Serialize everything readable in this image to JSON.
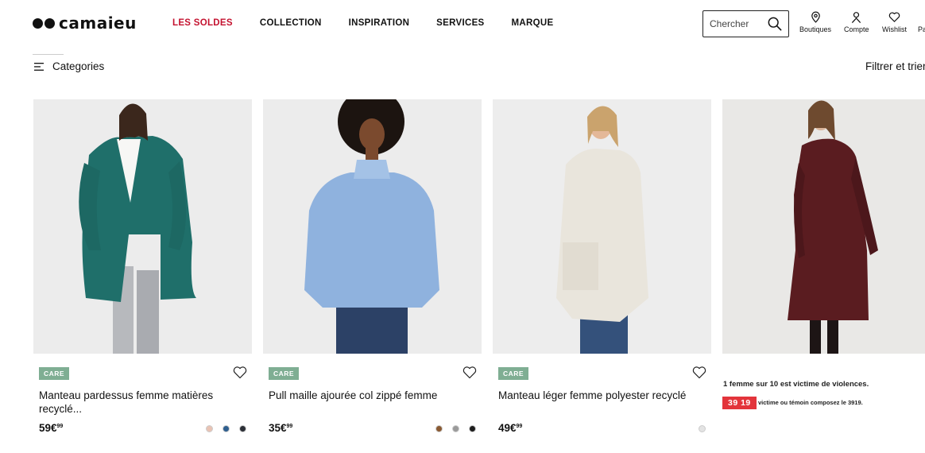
{
  "brand": {
    "name": "camaieu"
  },
  "nav": [
    {
      "label": "LES SOLDES"
    },
    {
      "label": "COLLECTION"
    },
    {
      "label": "INSPIRATION"
    },
    {
      "label": "SERVICES"
    },
    {
      "label": "MARQUE"
    }
  ],
  "search": {
    "placeholder": "Chercher"
  },
  "utilities": [
    {
      "label": "Boutiques",
      "icon": "store-pin-icon"
    },
    {
      "label": "Compte",
      "icon": "user-icon"
    },
    {
      "label": "Wishlist",
      "icon": "heart-icon"
    },
    {
      "label": "Pa",
      "icon": "bag-icon"
    }
  ],
  "toolbar": {
    "categories_label": "Categories",
    "filter_label": "Filtrer et trier"
  },
  "products": [
    {
      "badge": "CARE",
      "title": "Manteau pardessus femme matières recyclé...",
      "price_main": "59€",
      "price_cents": "99",
      "swatches": [
        "#e9c3b4",
        "#2f5f8f",
        "#2b2f36"
      ]
    },
    {
      "badge": "CARE",
      "title": "Pull maille ajourée col zippé femme",
      "price_main": "35€",
      "price_cents": "99",
      "swatches": [
        "#8a5a32",
        "#9a9a9a",
        "#1d1d1d"
      ]
    },
    {
      "badge": "CARE",
      "title": "Manteau léger femme polyester recyclé",
      "price_main": "49€",
      "price_cents": "99",
      "swatches": [
        "#e3e3e3"
      ]
    }
  ],
  "promo": {
    "line1": "1 femme sur 10 est victime de violences.",
    "phone": "39 19",
    "line2": "victime ou témoin composez le 3919."
  },
  "colors": {
    "sale": "#c4122f",
    "care_badge": "#7fae93",
    "promo_red": "#e3343b"
  }
}
